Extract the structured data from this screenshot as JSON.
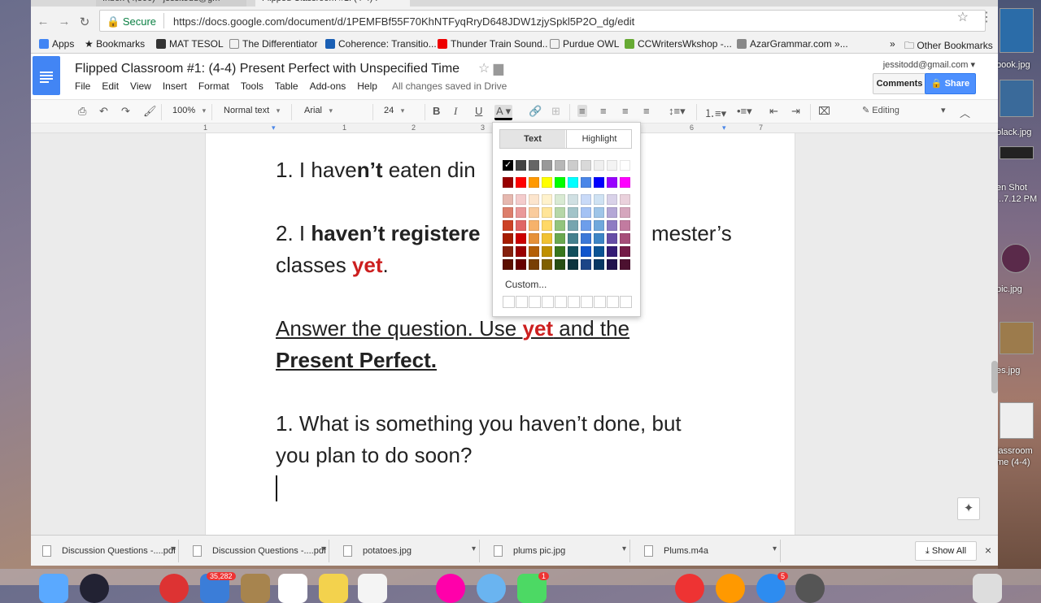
{
  "browser": {
    "tabs": [
      {
        "label": "Inbox (4,806) - jessitodd@gm",
        "active": false
      },
      {
        "label": "Flipped Classroom #1: (4-4) P",
        "active": true
      }
    ],
    "secure_label": "Secure",
    "url": "https://docs.google.com/document/d/1PEMFBf55F70KhNTFyqRryD648JDW1zjySpkl5P2O_dg/edit"
  },
  "bookmarks": {
    "items": [
      "Apps",
      "Bookmarks",
      "MAT TESOL",
      "The Differentiator",
      "Coherence: Transitio...",
      "Thunder Train Sound..",
      "Purdue OWL",
      "CCWritersWkshop -...",
      "AzarGrammar.com »..."
    ],
    "more": "»",
    "other": "Other Bookmarks"
  },
  "docs": {
    "title": "Flipped Classroom #1:  (4-4) Present Perfect with Unspecified Time",
    "menus": [
      "File",
      "Edit",
      "View",
      "Insert",
      "Format",
      "Tools",
      "Table",
      "Add-ons",
      "Help"
    ],
    "saved_status": "All changes saved in Drive",
    "account": "jessitodd@gmail.com",
    "comments_label": "Comments",
    "share_label": "Share"
  },
  "toolbar": {
    "zoom": "100%",
    "style": "Normal text",
    "font": "Arial",
    "size": "24",
    "mode": "Editing"
  },
  "ruler": [
    "1",
    "1",
    "2",
    "3",
    "6",
    "7"
  ],
  "palette": {
    "tab_text": "Text",
    "tab_highlight": "Highlight",
    "custom_label": "Custom...",
    "grays": [
      "#000000",
      "#434343",
      "#666666",
      "#999999",
      "#b7b7b7",
      "#cccccc",
      "#d9d9d9",
      "#efefef",
      "#f3f3f3",
      "#ffffff"
    ],
    "brights": [
      "#980000",
      "#ff0000",
      "#ff9900",
      "#ffff00",
      "#00ff00",
      "#00ffff",
      "#4a86e8",
      "#0000ff",
      "#9900ff",
      "#ff00ff"
    ],
    "shades": [
      [
        "#e6b8af",
        "#f4cccc",
        "#fce5cd",
        "#fff2cc",
        "#d9ead3",
        "#d0e0e3",
        "#c9daf8",
        "#cfe2f3",
        "#d9d2e9",
        "#ead1dc"
      ],
      [
        "#dd7e6b",
        "#ea9999",
        "#f9cb9c",
        "#ffe599",
        "#b6d7a8",
        "#a2c4c9",
        "#a4c2f4",
        "#9fc5e8",
        "#b4a7d6",
        "#d5a6bd"
      ],
      [
        "#cc4125",
        "#e06666",
        "#f6b26b",
        "#ffd966",
        "#93c47d",
        "#76a5af",
        "#6d9eeb",
        "#6fa8dc",
        "#8e7cc3",
        "#c27ba0"
      ],
      [
        "#a61c00",
        "#cc0000",
        "#e69138",
        "#f1c232",
        "#6aa84f",
        "#45818e",
        "#3c78d8",
        "#3d85c6",
        "#674ea7",
        "#a64d79"
      ],
      [
        "#85200c",
        "#990000",
        "#b45f06",
        "#bf9000",
        "#38761d",
        "#134f5c",
        "#1155cc",
        "#0b5394",
        "#351c75",
        "#741b47"
      ],
      [
        "#5b0f00",
        "#660000",
        "#783f04",
        "#7f6000",
        "#274e13",
        "#0c343d",
        "#1c4587",
        "#073763",
        "#20124d",
        "#4c1130"
      ]
    ]
  },
  "document": {
    "line1_a": "1. I have",
    "line1_b": "n’t",
    "line1_c": " eaten din",
    "line2_a": "2. I ",
    "line2_b": "haven’t registere",
    "line2_c": "mester’s",
    "line3_a": "classes ",
    "line3_b": "yet",
    "line3_c": ".",
    "line4_a": "Answer the question.  Use ",
    "line4_b": "yet",
    "line4_c": " and the",
    "line5": "Present Perfect.",
    "line6": "1. What is something you haven’t done, but",
    "line7": "you plan to do soon?"
  },
  "downloads": {
    "items": [
      "Discussion Questions -....pdf",
      "Discussion Questions -....pdf",
      "potatoes.jpg",
      "plums pic.jpg",
      "Plums.m4a"
    ],
    "show_all": "Show All",
    "close": "×"
  },
  "desktop": {
    "labels": [
      "book.jpg",
      "black.jpg",
      "en Shot",
      "...7.12 PM",
      "pic.jpg",
      "es.jpg",
      "lassroom",
      "me (4-4)"
    ]
  },
  "dock": {
    "badges": [
      "35,282",
      "1",
      "5"
    ]
  }
}
